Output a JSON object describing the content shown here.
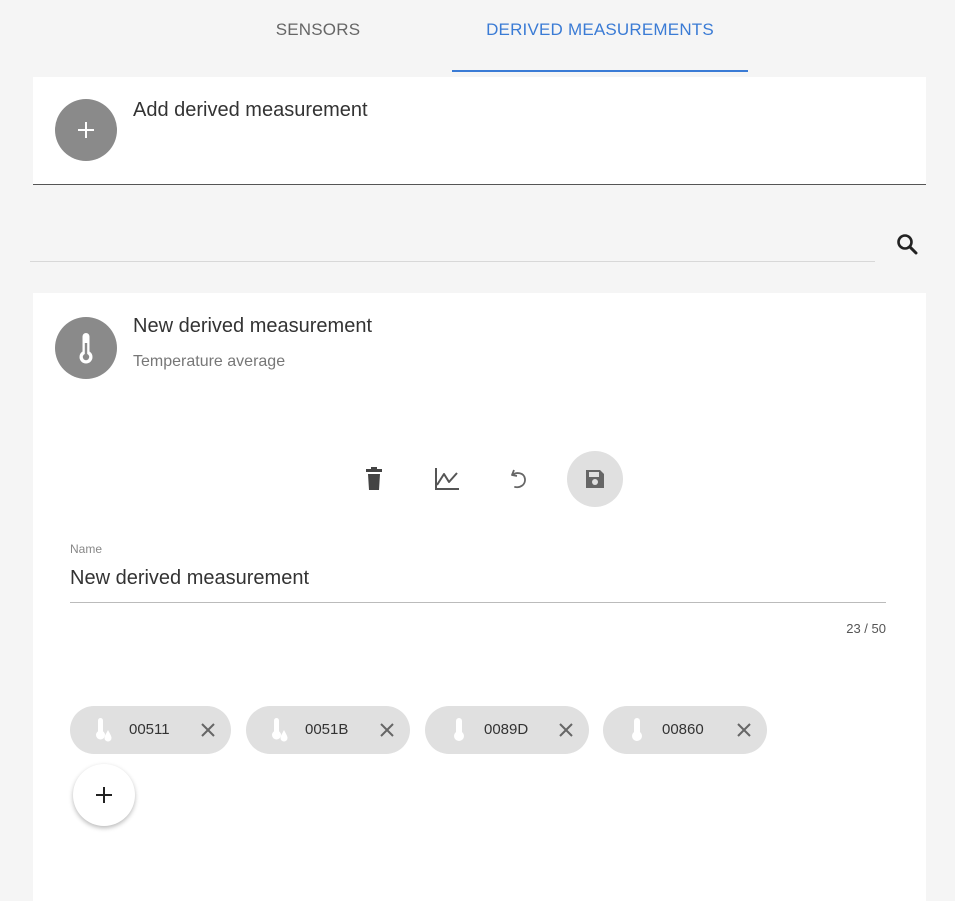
{
  "tabs": [
    {
      "label": "SENSORS",
      "active": false
    },
    {
      "label": "DERIVED MEASUREMENTS",
      "active": true
    }
  ],
  "accent_color": "#3a7bd5",
  "add_card": {
    "title": "Add derived measurement",
    "icon": "plus-icon"
  },
  "search": {
    "icon": "search-icon",
    "value": ""
  },
  "measurement": {
    "title": "New derived measurement",
    "subtitle": "Temperature average",
    "icon": "thermometer-icon",
    "actions": [
      "delete-icon",
      "chart-icon",
      "undo-icon",
      "save-icon"
    ],
    "name_field": {
      "label": "Name",
      "value": "New derived measurement",
      "counter": "23 / 50"
    },
    "sensors": [
      {
        "label": "00511",
        "icon": "thermometer-humidity-icon"
      },
      {
        "label": "0051B",
        "icon": "thermometer-humidity-icon"
      },
      {
        "label": "0089D",
        "icon": "thermometer-icon"
      },
      {
        "label": "00860",
        "icon": "thermometer-icon"
      }
    ],
    "add_sensor_icon": "plus-icon"
  }
}
